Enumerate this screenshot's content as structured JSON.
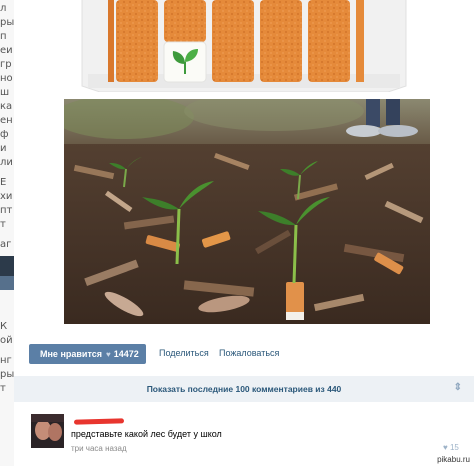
{
  "sidebar_fragments": [
    "л",
    "ры",
    "п",
    "еи",
    "гр",
    "но",
    "ш",
    "ка",
    "ен",
    "ф",
    "и",
    "ли",
    "Е",
    "хи",
    "пт",
    "т",
    "аг",
    "К",
    "ой",
    "нг",
    "ры",
    "т"
  ],
  "post": {
    "like_label": "Мне нравится",
    "like_count": "14472",
    "share_label": "Поделиться",
    "report_label": "Пожаловаться"
  },
  "comments_bar": {
    "show_label": "Показать последние 100 комментариев из 440"
  },
  "comment": {
    "text": "представьте какой лес будет у школ",
    "time": "три часа назад",
    "likes": "15"
  },
  "watermark": "pikabu.ru",
  "colors": {
    "like_button": "#5b7fa6",
    "link": "#2b587a",
    "bar_bg": "#edf1f5",
    "redaction": "#e8352e"
  },
  "icons": {
    "like": "heart-icon",
    "collapse": "arrows-icon",
    "comment_like": "heart-icon"
  }
}
